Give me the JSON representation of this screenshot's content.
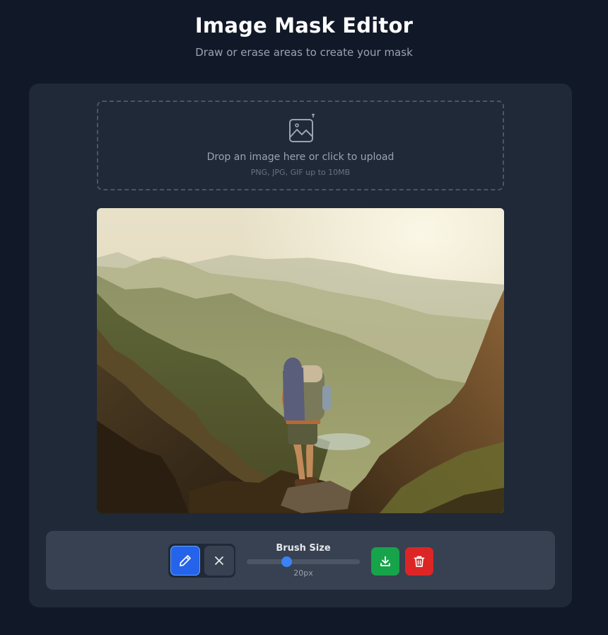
{
  "header": {
    "title": "Image Mask Editor",
    "subtitle": "Draw or erase areas to create your mask"
  },
  "upload": {
    "icon": "image-plus-icon",
    "prompt": "Drop an image here or click to upload",
    "hint": "PNG, JPG, GIF up to 10MB"
  },
  "canvas": {
    "image_description_icon": "mountain-hiker-photo"
  },
  "toolbar": {
    "tools": [
      {
        "name": "brush",
        "icon": "pencil-icon",
        "active": true
      },
      {
        "name": "eraser",
        "icon": "x-icon",
        "active": false
      }
    ],
    "brush_size_label": "Brush Size",
    "brush_size_value": "20px",
    "brush_size_fraction": 0.35,
    "download_icon": "download-icon",
    "clear_icon": "trash-icon"
  },
  "colors": {
    "background": "#111827",
    "panel": "#1f2937",
    "toolbar": "#374151",
    "accent": "#2563eb",
    "download": "#16a34a",
    "clear": "#dc2626"
  }
}
